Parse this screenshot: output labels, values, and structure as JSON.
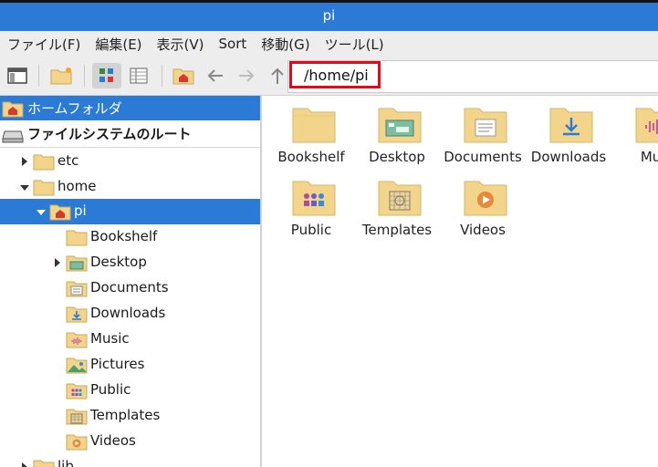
{
  "window": {
    "title": "pi"
  },
  "menu": [
    "ファイル(F)",
    "編集(E)",
    "表示(V)",
    "Sort",
    "移動(G)",
    "ツール(L)"
  ],
  "path": {
    "value": "/home/pi"
  },
  "places": [
    {
      "label": "ホームフォルダ",
      "icon": "home-icon",
      "selected": true
    },
    {
      "label": "ファイルシステムのルート",
      "icon": "drive-icon",
      "selected": false
    }
  ],
  "tree": {
    "items": [
      {
        "label": "etc",
        "icon": "folder"
      },
      {
        "label": "home",
        "icon": "folder"
      },
      {
        "label": "pi",
        "icon": "home-folder"
      },
      {
        "label": "Bookshelf",
        "icon": "folder"
      },
      {
        "label": "Desktop",
        "icon": "desktop-folder"
      },
      {
        "label": "Documents",
        "icon": "documents-folder"
      },
      {
        "label": "Downloads",
        "icon": "downloads-folder"
      },
      {
        "label": "Music",
        "icon": "music-folder"
      },
      {
        "label": "Pictures",
        "icon": "pictures-folder"
      },
      {
        "label": "Public",
        "icon": "public-folder"
      },
      {
        "label": "Templates",
        "icon": "templates-folder"
      },
      {
        "label": "Videos",
        "icon": "videos-folder"
      },
      {
        "label": "lib",
        "icon": "folder"
      }
    ]
  },
  "main": {
    "items": [
      {
        "label": "Bookshelf",
        "icon": "folder"
      },
      {
        "label": "Desktop",
        "icon": "desktop-folder"
      },
      {
        "label": "Documents",
        "icon": "documents-folder"
      },
      {
        "label": "Downloads",
        "icon": "downloads-folder"
      },
      {
        "label": "Mus",
        "icon": "music-folder"
      },
      {
        "label": "Public",
        "icon": "public-folder"
      },
      {
        "label": "Templates",
        "icon": "templates-folder"
      },
      {
        "label": "Videos",
        "icon": "videos-folder"
      }
    ]
  },
  "colors": {
    "accent": "#2a7ad6",
    "folder": "#f2d58a",
    "highlight": "#e4081a"
  }
}
